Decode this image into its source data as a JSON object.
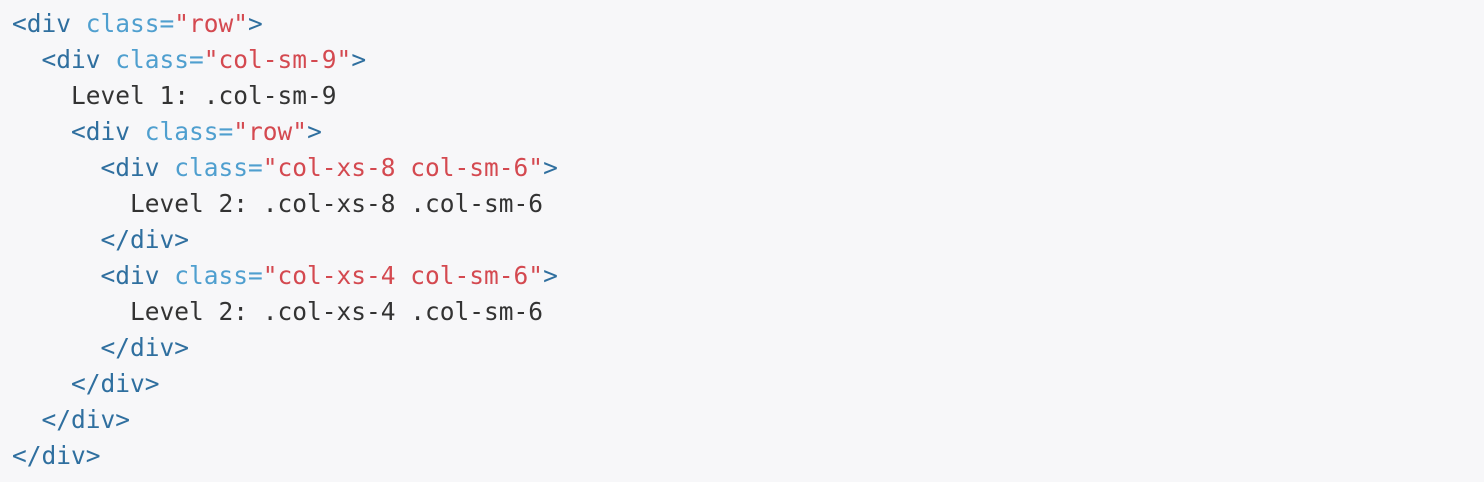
{
  "code": {
    "lines": [
      {
        "indent": "",
        "tokens": [
          {
            "type": "tag",
            "text": "<div "
          },
          {
            "type": "attr",
            "text": "class="
          },
          {
            "type": "str",
            "text": "\"row\""
          },
          {
            "type": "tag",
            "text": ">"
          }
        ]
      },
      {
        "indent": "  ",
        "tokens": [
          {
            "type": "tag",
            "text": "<div "
          },
          {
            "type": "attr",
            "text": "class="
          },
          {
            "type": "str",
            "text": "\"col-sm-9\""
          },
          {
            "type": "tag",
            "text": ">"
          }
        ]
      },
      {
        "indent": "    ",
        "tokens": [
          {
            "type": "text",
            "text": "Level 1: .col-sm-9"
          }
        ]
      },
      {
        "indent": "    ",
        "tokens": [
          {
            "type": "tag",
            "text": "<div "
          },
          {
            "type": "attr",
            "text": "class="
          },
          {
            "type": "str",
            "text": "\"row\""
          },
          {
            "type": "tag",
            "text": ">"
          }
        ]
      },
      {
        "indent": "      ",
        "tokens": [
          {
            "type": "tag",
            "text": "<div "
          },
          {
            "type": "attr",
            "text": "class="
          },
          {
            "type": "str",
            "text": "\"col-xs-8 col-sm-6\""
          },
          {
            "type": "tag",
            "text": ">"
          }
        ]
      },
      {
        "indent": "        ",
        "tokens": [
          {
            "type": "text",
            "text": "Level 2: .col-xs-8 .col-sm-6"
          }
        ]
      },
      {
        "indent": "      ",
        "tokens": [
          {
            "type": "tag",
            "text": "</div>"
          }
        ]
      },
      {
        "indent": "      ",
        "tokens": [
          {
            "type": "tag",
            "text": "<div "
          },
          {
            "type": "attr",
            "text": "class="
          },
          {
            "type": "str",
            "text": "\"col-xs-4 col-sm-6\""
          },
          {
            "type": "tag",
            "text": ">"
          }
        ]
      },
      {
        "indent": "        ",
        "tokens": [
          {
            "type": "text",
            "text": "Level 2: .col-xs-4 .col-sm-6"
          }
        ]
      },
      {
        "indent": "      ",
        "tokens": [
          {
            "type": "tag",
            "text": "</div>"
          }
        ]
      },
      {
        "indent": "    ",
        "tokens": [
          {
            "type": "tag",
            "text": "</div>"
          }
        ]
      },
      {
        "indent": "  ",
        "tokens": [
          {
            "type": "tag",
            "text": "</div>"
          }
        ]
      },
      {
        "indent": "",
        "tokens": [
          {
            "type": "tag",
            "text": "</div>"
          }
        ]
      }
    ],
    "colors": {
      "background": "#f7f7f9",
      "tag": "#2f6f9f",
      "attribute": "#4f9fcf",
      "string": "#d44950",
      "text": "#333333"
    }
  }
}
